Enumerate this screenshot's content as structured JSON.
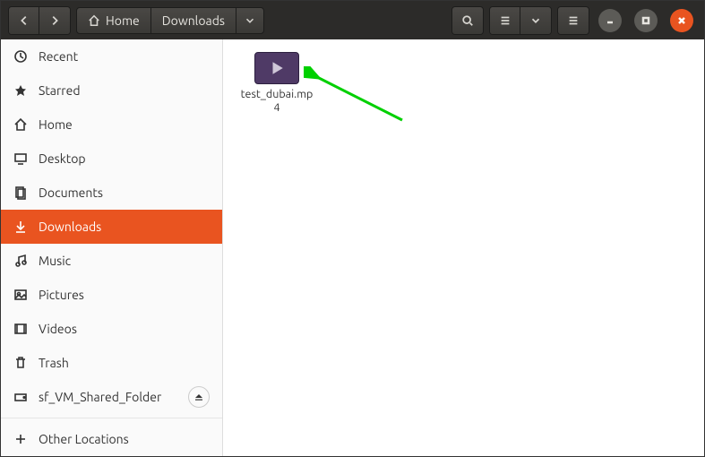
{
  "breadcrumb": {
    "home": "Home",
    "current": "Downloads"
  },
  "sidebar": {
    "items": [
      {
        "label": "Recent"
      },
      {
        "label": "Starred"
      },
      {
        "label": "Home"
      },
      {
        "label": "Desktop"
      },
      {
        "label": "Documents"
      },
      {
        "label": "Downloads"
      },
      {
        "label": "Music"
      },
      {
        "label": "Pictures"
      },
      {
        "label": "Videos"
      },
      {
        "label": "Trash"
      },
      {
        "label": "sf_VM_Shared_Folder"
      }
    ],
    "other_locations": "Other Locations"
  },
  "files": [
    {
      "name": "test_dubai.mp4"
    }
  ],
  "colors": {
    "accent": "#e95420"
  }
}
